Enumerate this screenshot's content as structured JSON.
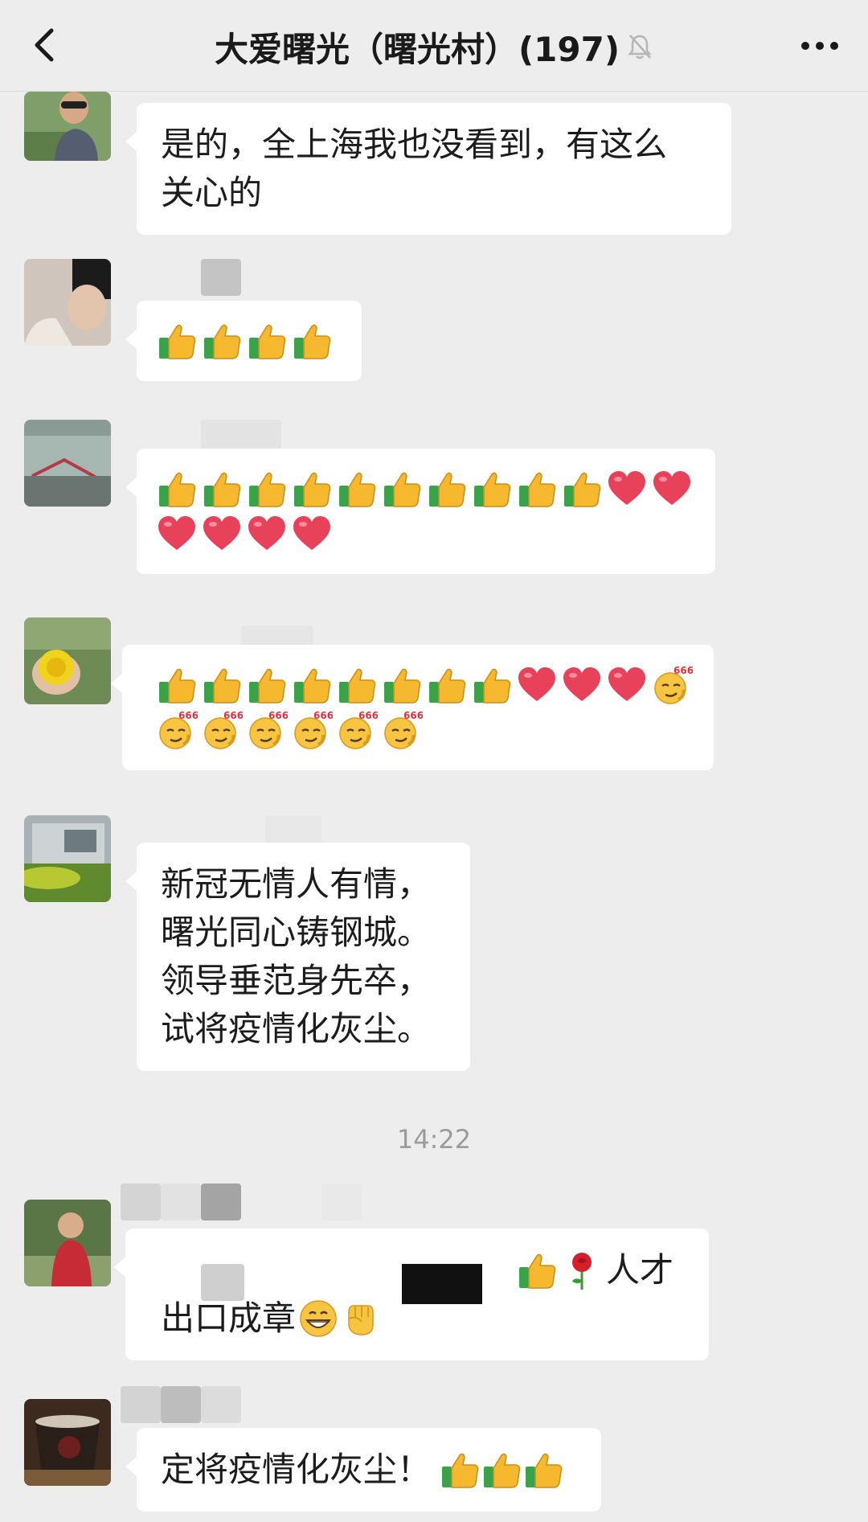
{
  "header": {
    "title": "大爱曙光（曙光村）(197)"
  },
  "messages": [
    {
      "text_lines": [
        "是的，全上海我也没看到，有这么",
        "关心的"
      ]
    },
    {
      "emojis": [
        "thumbs-up",
        "thumbs-up",
        "thumbs-up",
        "thumbs-up"
      ]
    },
    {
      "emojis": [
        "thumbs-up",
        "thumbs-up",
        "thumbs-up",
        "thumbs-up",
        "thumbs-up",
        "thumbs-up",
        "thumbs-up",
        "thumbs-up",
        "thumbs-up",
        "thumbs-up",
        "heart",
        "heart",
        "heart",
        "heart",
        "heart",
        "heart"
      ]
    },
    {
      "emojis": [
        "thumbs-up",
        "thumbs-up",
        "thumbs-up",
        "thumbs-up",
        "thumbs-up",
        "thumbs-up",
        "thumbs-up",
        "thumbs-up",
        "heart",
        "heart",
        "heart",
        "666",
        "666",
        "666",
        "666",
        "666",
        "666",
        "666"
      ]
    },
    {
      "text_lines": [
        "新冠无情人有情，",
        "曙光同心铸钢城。",
        "领导垂范身先卒，",
        "试将疫情化灰尘。"
      ]
    },
    {
      "time": "14:22"
    },
    {
      "text_line1_tail": "人才",
      "text_line2": "出口成章"
    },
    {
      "text": "定将疫情化灰尘！"
    }
  ],
  "emoji_label_666": "666",
  "colors": {
    "background": "#ededed",
    "bubble": "#ffffff",
    "heart": "#e8415a",
    "thumb": "#f5b82e",
    "cuff": "#3aa34a"
  }
}
